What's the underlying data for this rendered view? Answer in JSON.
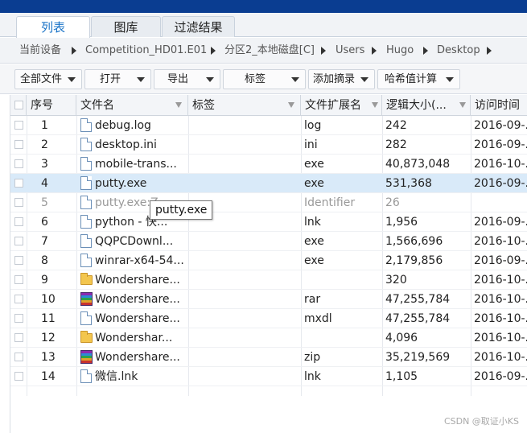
{
  "tabs": [
    {
      "label": "列表",
      "active": true
    },
    {
      "label": "图库",
      "active": false
    },
    {
      "label": "过滤结果",
      "active": false
    }
  ],
  "breadcrumb": [
    "当前设备",
    "Competition_HD01.E01",
    "分区2_本地磁盘[C]",
    "Users",
    "Hugo",
    "Desktop"
  ],
  "toolbar": [
    "全部文件",
    "打开",
    "导出",
    "标签",
    "添加摘录",
    "哈希值计算"
  ],
  "columns": [
    "序号",
    "文件名",
    "标签",
    "文件扩展名",
    "逻辑大小(...",
    "访问时间"
  ],
  "rows": [
    {
      "no": "1",
      "icon": "document-icon",
      "name": "debug.log",
      "tag": "",
      "ext": "log",
      "size": "242",
      "time": "2016-09-..."
    },
    {
      "no": "2",
      "icon": "document-icon",
      "name": "desktop.ini",
      "tag": "",
      "ext": "ini",
      "size": "282",
      "time": "2016-09-..."
    },
    {
      "no": "3",
      "icon": "document-icon",
      "name": "mobile-trans...",
      "tag": "",
      "ext": "exe",
      "size": "40,873,048",
      "time": "2016-10-..."
    },
    {
      "no": "4",
      "icon": "document-icon",
      "name": "putty.exe",
      "tag": "",
      "ext": "exe",
      "size": "531,368",
      "time": "2016-09-..."
    },
    {
      "no": "5",
      "icon": "document-icon",
      "name": "putty.exe:Z...",
      "tag": "",
      "ext": "Identifier",
      "size": "26",
      "time": ""
    },
    {
      "no": "6",
      "icon": "document-icon",
      "name": "python - 快...",
      "tag": "",
      "ext": "lnk",
      "size": "1,956",
      "time": "2016-09-..."
    },
    {
      "no": "7",
      "icon": "document-icon",
      "name": "QQPCDownl...",
      "tag": "",
      "ext": "exe",
      "size": "1,566,696",
      "time": "2016-10-..."
    },
    {
      "no": "8",
      "icon": "document-icon",
      "name": "winrar-x64-54...",
      "tag": "",
      "ext": "exe",
      "size": "2,179,856",
      "time": "2016-09-..."
    },
    {
      "no": "9",
      "icon": "folder-icon",
      "name": "Wondershare...",
      "tag": "",
      "ext": "",
      "size": "320",
      "time": "2016-10-..."
    },
    {
      "no": "10",
      "icon": "archive-icon",
      "name": "Wondershare...",
      "tag": "",
      "ext": "rar",
      "size": "47,255,784",
      "time": "2016-10-..."
    },
    {
      "no": "11",
      "icon": "document-icon",
      "name": "Wondershare...",
      "tag": "",
      "ext": "mxdl",
      "size": "47,255,784",
      "time": "2016-10-..."
    },
    {
      "no": "12",
      "icon": "folder-icon",
      "name": "Wondershar...",
      "tag": "",
      "ext": "",
      "size": "4,096",
      "time": "2016-10-..."
    },
    {
      "no": "13",
      "icon": "archive-icon",
      "name": "Wondershare...",
      "tag": "",
      "ext": "zip",
      "size": "35,219,569",
      "time": "2016-10-..."
    },
    {
      "no": "14",
      "icon": "document-icon",
      "name": "微信.lnk",
      "tag": "",
      "ext": "lnk",
      "size": "1,105",
      "time": "2016-09-..."
    }
  ],
  "selected_row": "4",
  "dimmed_row": "5",
  "tooltip": "putty.exe",
  "watermark": "CSDN @取证小KS",
  "colors": {
    "accent": "#1a73c7",
    "topbar": "#0a3d91",
    "selection": "#d9eaf9"
  }
}
